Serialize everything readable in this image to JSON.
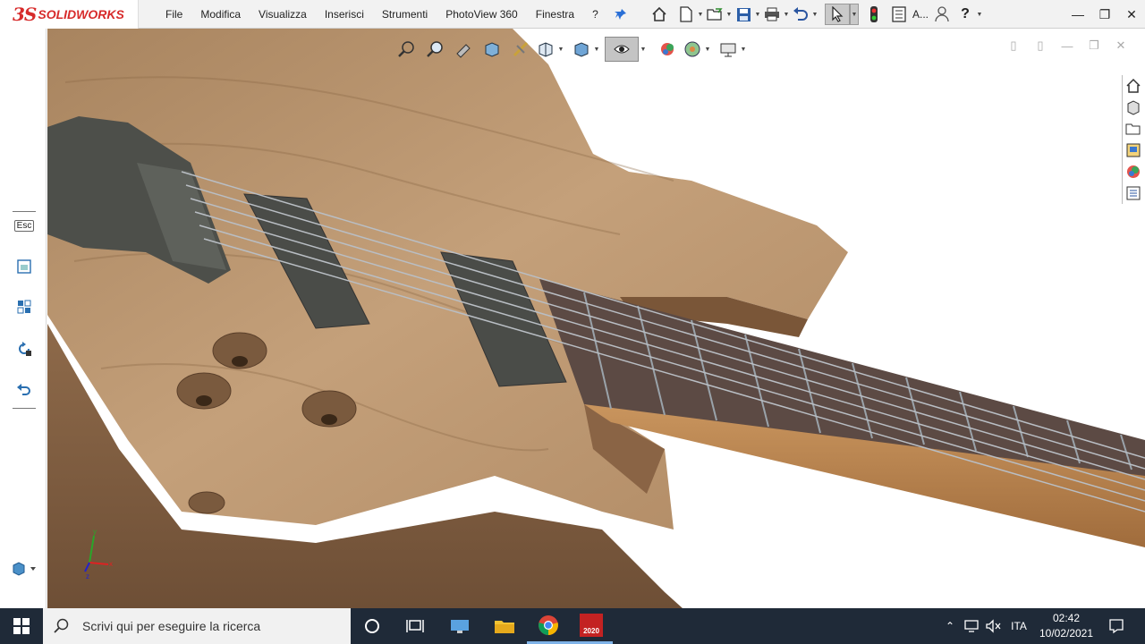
{
  "app": {
    "brand_prefix": "3S",
    "brand_name": "SOLIDWORKS"
  },
  "menu": [
    "File",
    "Modifica",
    "Visualizza",
    "Inserisci",
    "Strumenti",
    "PhotoView 360",
    "Finestra",
    "?"
  ],
  "quick_access": {
    "truncated_label": "A..."
  },
  "left_panel": {
    "esc_label": "Esc"
  },
  "taskbar": {
    "search_placeholder": "Scrivi qui per eseguire la ricerca",
    "sw_badge": "2020",
    "language": "ITA",
    "time": "02:42",
    "date": "10/02/2021"
  },
  "triad": {
    "x": "x",
    "y": "y",
    "z": "z"
  },
  "colors": {
    "accent": "#d72b2b",
    "taskbar": "#1f2a38",
    "wood": "#b8916a"
  }
}
